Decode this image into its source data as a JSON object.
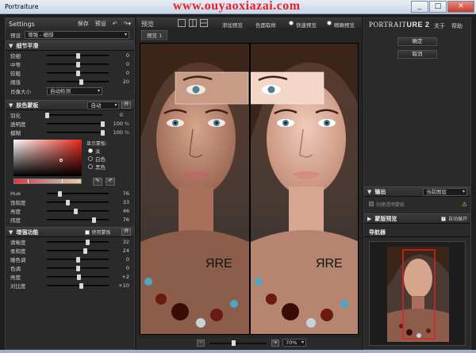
{
  "window": {
    "title": "Portraiture",
    "watermark": "www.ouyaoxiazai.com",
    "minimize": "_",
    "maximize": "□",
    "close": "✕"
  },
  "left": {
    "header": {
      "title": "Settings",
      "save": "保存",
      "preset": "预设"
    },
    "preset": {
      "label": "预设",
      "value": "增强 - 细部"
    },
    "detail": {
      "title": "细节平滑",
      "rows": [
        {
          "label": "较细",
          "value": "0",
          "level": 0.5
        },
        {
          "label": "中等",
          "value": "0",
          "level": 0.5
        },
        {
          "label": "较粗",
          "value": "0",
          "level": 0.5
        },
        {
          "label": "阈值",
          "value": "20",
          "level": 0.55
        }
      ],
      "size_label": "肖像大小",
      "size_value": "自动检测"
    },
    "mask": {
      "title": "肤色蒙板",
      "mode": "自动",
      "toggle": "开",
      "rows": [
        {
          "label": "羽化",
          "value": "0",
          "unit": "",
          "level": 0.0
        },
        {
          "label": "透明度",
          "value": "100",
          "unit": "%",
          "level": 1.0
        },
        {
          "label": "模糊",
          "value": "100",
          "unit": "%",
          "level": 1.0
        }
      ],
      "show_label": "显示蒙板:",
      "options": [
        "关",
        "白色",
        "黑色"
      ],
      "selected_option": 0,
      "hsb": [
        {
          "label": "Hue",
          "value": "76",
          "level": 0.21
        },
        {
          "label": "饱和度",
          "value": "33",
          "level": 0.33
        },
        {
          "label": "亮度",
          "value": "46",
          "level": 0.46
        },
        {
          "label": "纬度",
          "value": "76",
          "level": 0.76
        }
      ]
    },
    "enhance": {
      "title": "增强功能",
      "checkbox_label": "使用蒙板",
      "toggle": "开",
      "rows": [
        {
          "label": "清晰度",
          "value": "32",
          "level": 0.66
        },
        {
          "label": "柔和度",
          "value": "24",
          "level": 0.62
        },
        {
          "label": "暖色调",
          "value": "0",
          "level": 0.5
        },
        {
          "label": "色调",
          "value": "0",
          "level": 0.5
        },
        {
          "label": "亮度",
          "value": "+2",
          "level": 0.51
        },
        {
          "label": "对比度",
          "value": "+10",
          "level": 0.55
        }
      ]
    }
  },
  "center": {
    "toolbar": {
      "title": "预览",
      "add_preview": "添加预览",
      "skin_sample": "色面取样",
      "fast_preview": "快速预览",
      "accurate_preview": "精确预览"
    },
    "tab": "预览 1",
    "overlay_text": "ЯRE",
    "zoom": "70%",
    "zoom_minus": "-",
    "zoom_plus": "+"
  },
  "right": {
    "logo_a": "PORTRAIT",
    "logo_b": "URE 2",
    "about": "关于",
    "help": "帮助",
    "ok": "确定",
    "cancel": "取消",
    "output": {
      "title": "输出",
      "value": "当前图层",
      "checkbox": "创建透明蒙板"
    },
    "mask_preview": {
      "title": "蒙版预览",
      "auto_open": "自动展开"
    },
    "navigator": {
      "title": "导航器"
    }
  },
  "colors": {
    "accent_red": "#e8202a",
    "panel": "#2a2a2a",
    "nav_box": "#e02020"
  }
}
